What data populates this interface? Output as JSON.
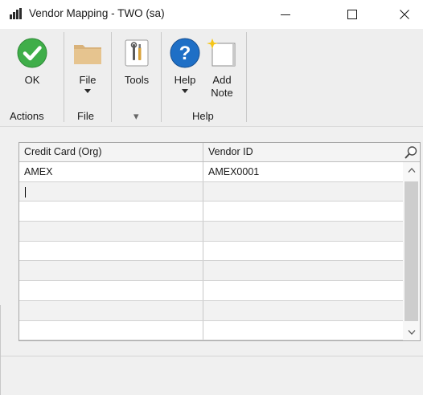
{
  "window": {
    "title": "Vendor Mapping  -  TWO (sa)",
    "icon": "chart-app-icon",
    "controls": [
      "minimize-icon",
      "maximize-icon",
      "close-icon"
    ]
  },
  "ribbon": {
    "buttons": {
      "ok": {
        "label": "OK",
        "icon": "check-circle-icon"
      },
      "file": {
        "label": "File",
        "icon": "folder-icon"
      },
      "tools": {
        "label": "Tools",
        "icon": "tools-icon"
      },
      "help": {
        "label": "Help",
        "icon": "help-circle-icon"
      },
      "add_note": {
        "label_line1": "Add",
        "label_line2": "Note",
        "icon": "note-icon"
      }
    },
    "groups": {
      "actions": "Actions",
      "file": "File",
      "tools": "▾",
      "help": "Help"
    }
  },
  "grid": {
    "columns": [
      "Credit Card (Org)",
      "Vendor ID"
    ],
    "rows": [
      [
        "AMEX",
        "AMEX0001"
      ],
      [
        "",
        ""
      ],
      [
        "",
        ""
      ],
      [
        "",
        ""
      ],
      [
        "",
        ""
      ],
      [
        "",
        ""
      ],
      [
        "",
        ""
      ],
      [
        "",
        ""
      ],
      [
        "",
        ""
      ]
    ],
    "active_row": 1
  },
  "colors": {
    "ok_green": "#3fae49",
    "help_blue": "#1e6fc6",
    "folder": "#d9b27a",
    "row_alt": "#f2f2f2"
  }
}
